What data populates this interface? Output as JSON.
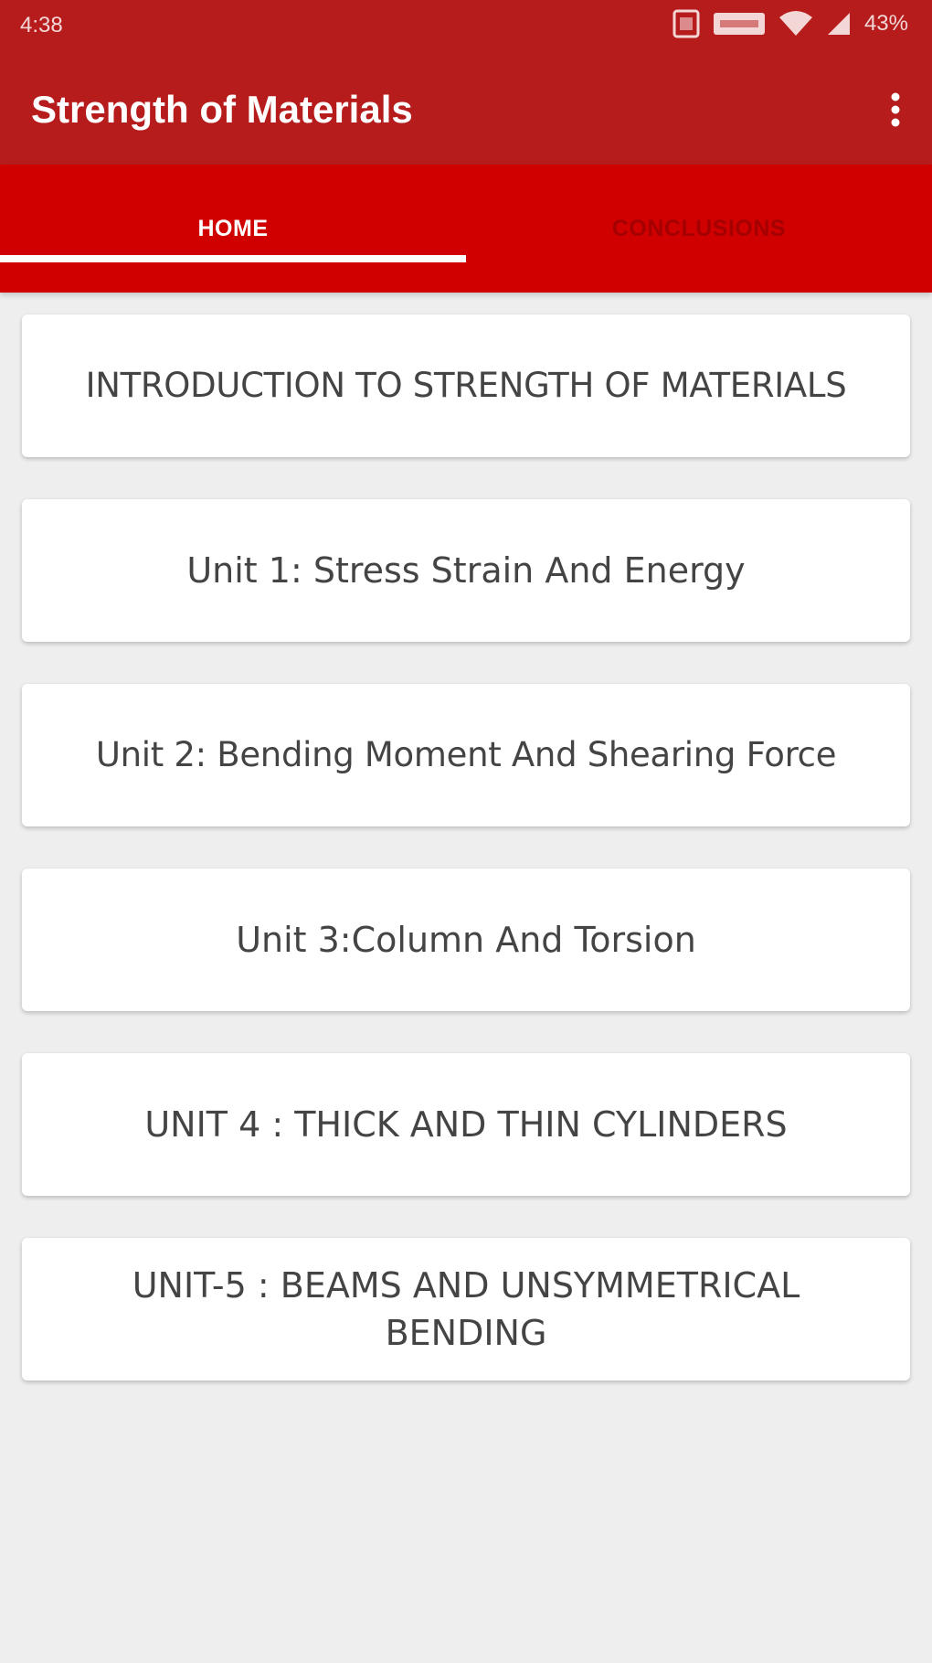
{
  "status_bar": {
    "time": "4:38",
    "battery": "43%"
  },
  "app_bar": {
    "title": "Strength of Materials"
  },
  "tabs": [
    {
      "label": "HOME",
      "selected": true
    },
    {
      "label": "CONCLUSIONS",
      "selected": false
    }
  ],
  "topics": [
    {
      "label": "INTRODUCTION TO STRENGTH OF MATERIALS"
    },
    {
      "label": "Unit 1: Stress Strain And Energy"
    },
    {
      "label": "Unit  2: Bending Moment And Shearing Force"
    },
    {
      "label": "Unit 3:Column And Torsion"
    },
    {
      "label": "UNIT 4 : THICK AND THIN CYLINDERS"
    },
    {
      "label": "UNIT-5 : BEAMS AND UNSYMMETRICAL\nBENDING"
    }
  ],
  "colors": {
    "status_bar": "#b71c1c",
    "app_bar": "#b71c1c",
    "tab_bar": "#d00000",
    "background": "#eeeeee"
  }
}
